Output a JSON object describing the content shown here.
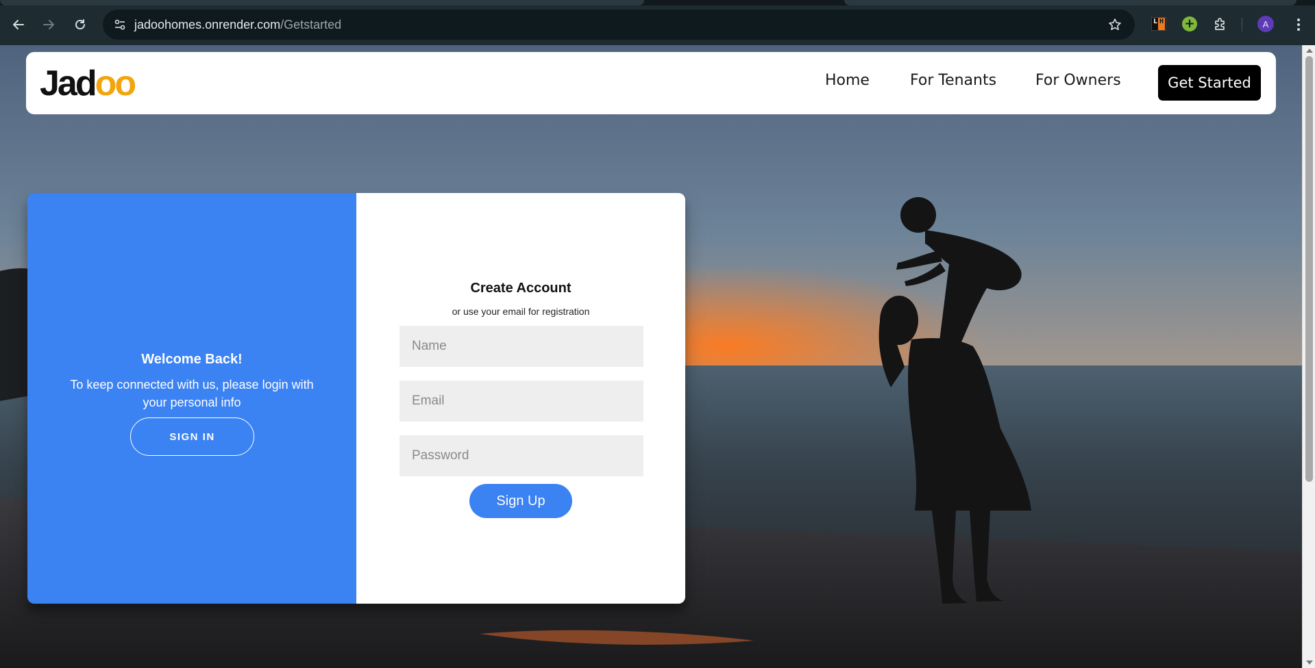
{
  "browser": {
    "url_host": "jadoohomes.onrender.com",
    "url_path": "/Getstarted",
    "profile_initial": "A",
    "extensions": [
      "lighthouse-icon",
      "plus-extension-icon",
      "puzzle-icon"
    ]
  },
  "navbar": {
    "logo_text_prefix": "Jad",
    "logo_text_accent": "oo",
    "links": [
      "Home",
      "For Tenants",
      "For Owners"
    ],
    "cta_label": "Get Started"
  },
  "auth": {
    "left": {
      "title": "Welcome Back!",
      "message": "To keep connected with us, please login with your personal info",
      "button_label": "SIGN IN"
    },
    "right": {
      "title": "Create Account",
      "subtitle": "or use your email for registration",
      "name_placeholder": "Name",
      "email_placeholder": "Email",
      "password_placeholder": "Password",
      "button_label": "Sign Up"
    }
  },
  "colors": {
    "accent_blue": "#3b82f3",
    "logo_accent": "#f3a50d",
    "cta_bg": "#000000"
  }
}
